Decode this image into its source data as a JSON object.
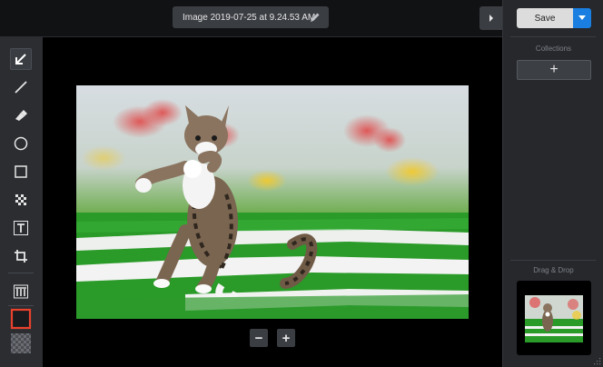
{
  "document": {
    "title": "Image 2019-07-25 at 9.24.53 AM"
  },
  "toolbar": {
    "tools": [
      {
        "name": "arrow",
        "icon": "arrow-icon",
        "active": true
      },
      {
        "name": "line",
        "icon": "line-icon"
      },
      {
        "name": "highlighter",
        "icon": "highlighter-icon"
      },
      {
        "name": "ellipse",
        "icon": "ellipse-icon"
      },
      {
        "name": "rectangle",
        "icon": "rectangle-icon"
      },
      {
        "name": "pixelate",
        "icon": "pixelate-icon"
      },
      {
        "name": "text",
        "icon": "text-icon"
      },
      {
        "name": "crop",
        "icon": "crop-icon"
      },
      {
        "name": "step",
        "icon": "step-icon"
      }
    ],
    "stroke_color": "#e8412c",
    "fill_color": "transparent"
  },
  "zoom": {
    "out_label": "−",
    "in_label": "+"
  },
  "right_panel": {
    "save_label": "Save",
    "collections_label": "Collections",
    "add_label": "+",
    "drag_drop_label": "Drag & Drop"
  },
  "colors": {
    "accent": "#1a7fe0",
    "panel_bg": "#26282c",
    "toolbar_bg": "#2b2d31",
    "highlight_red": "#e8412c"
  }
}
